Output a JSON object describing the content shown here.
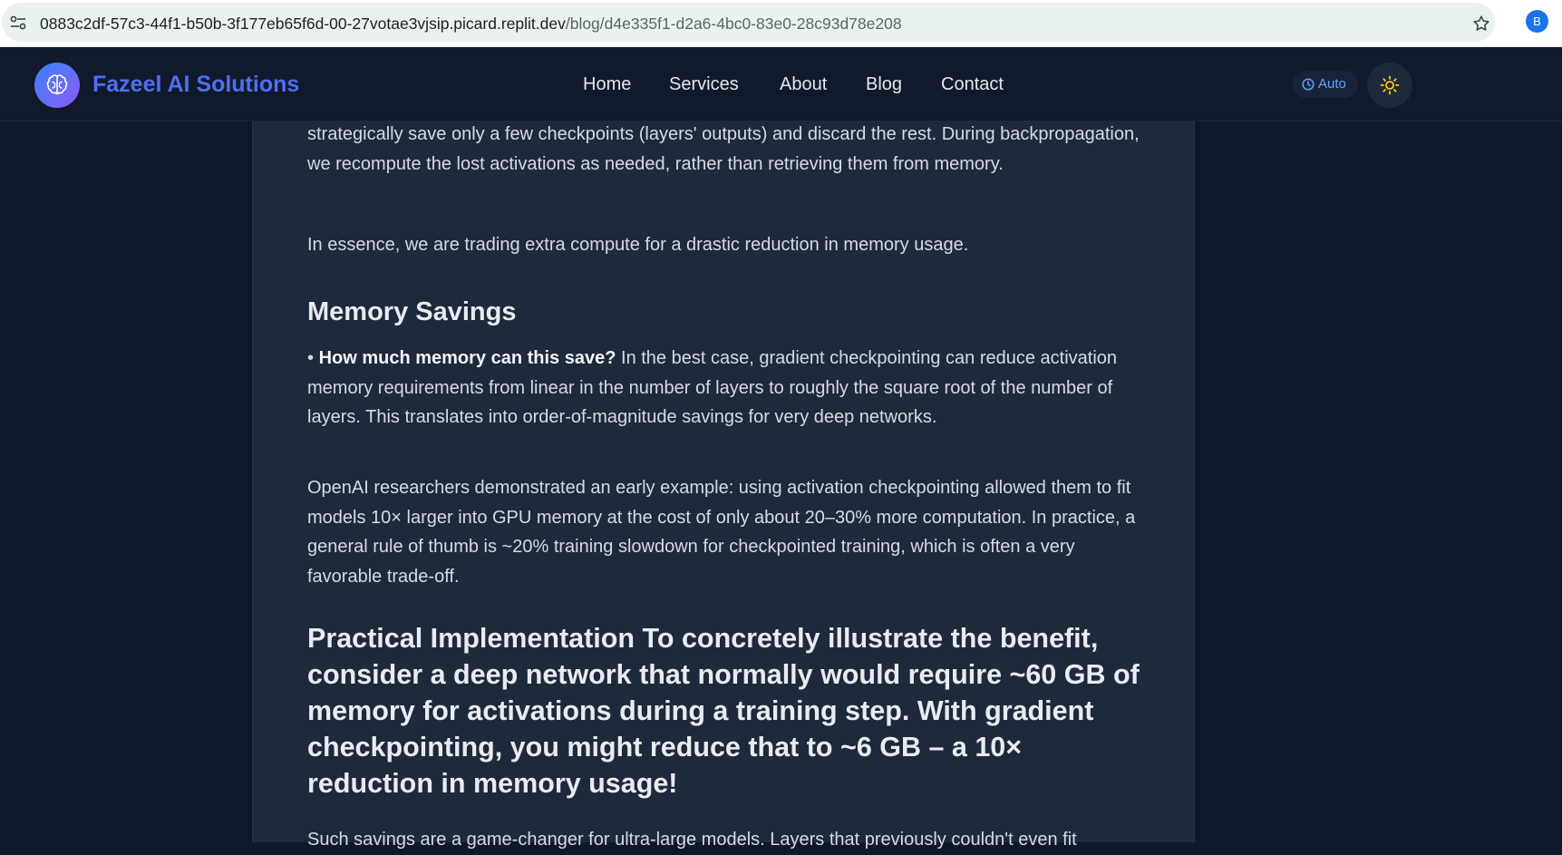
{
  "browser": {
    "url_host": "0883c2df-57c3-44f1-b50b-3f177eb65f6d-00-27votae3vjsip.picard.replit.dev",
    "url_path": "/blog/d4e335f1-d2a6-4bc0-83e0-28c93d78e208",
    "profile_initial": "B"
  },
  "header": {
    "brand": "Fazeel AI Solutions",
    "nav": [
      "Home",
      "Services",
      "About",
      "Blog",
      "Contact"
    ],
    "theme_mode": "Auto"
  },
  "article": {
    "para_checkpoints": "strategically save only a few checkpoints (layers' outputs) and discard the rest. During backpropagation, we recompute the lost activations as needed, rather than retrieving them from memory.",
    "para_essence": "In essence, we are trading extra compute for a drastic reduction in memory usage.",
    "heading_memory": "Memory Savings",
    "bullet_question": "How much memory can this save?",
    "bullet_text": " In the best case, gradient checkpointing can reduce activation memory requirements from linear in the number of layers to roughly the square root of the number of layers. This translates into order-of-magnitude savings for very deep networks.",
    "para_openai": "OpenAI researchers demonstrated an early example: using activation checkpointing allowed them to fit models 10× larger into GPU memory at the cost of only about 20–30% more computation. In practice, a general rule of thumb is ~20% training slowdown for checkpointed training, which is often a very favorable trade-off.",
    "heading_practical": "Practical Implementation To concretely illustrate the benefit, consider a deep network that normally would require ~60 GB of memory for activations during a training step. With gradient checkpointing, you might reduce that to ~6 GB – a 10× reduction in memory usage!",
    "para_savings": "Such savings are a game-changer for ultra-large models. Layers that previously couldn't even fit"
  },
  "colors": {
    "page_bg": "#0f172a",
    "card_bg": "#1e293b",
    "brand": "#4f6ff0",
    "accent": "#60a5fa"
  }
}
